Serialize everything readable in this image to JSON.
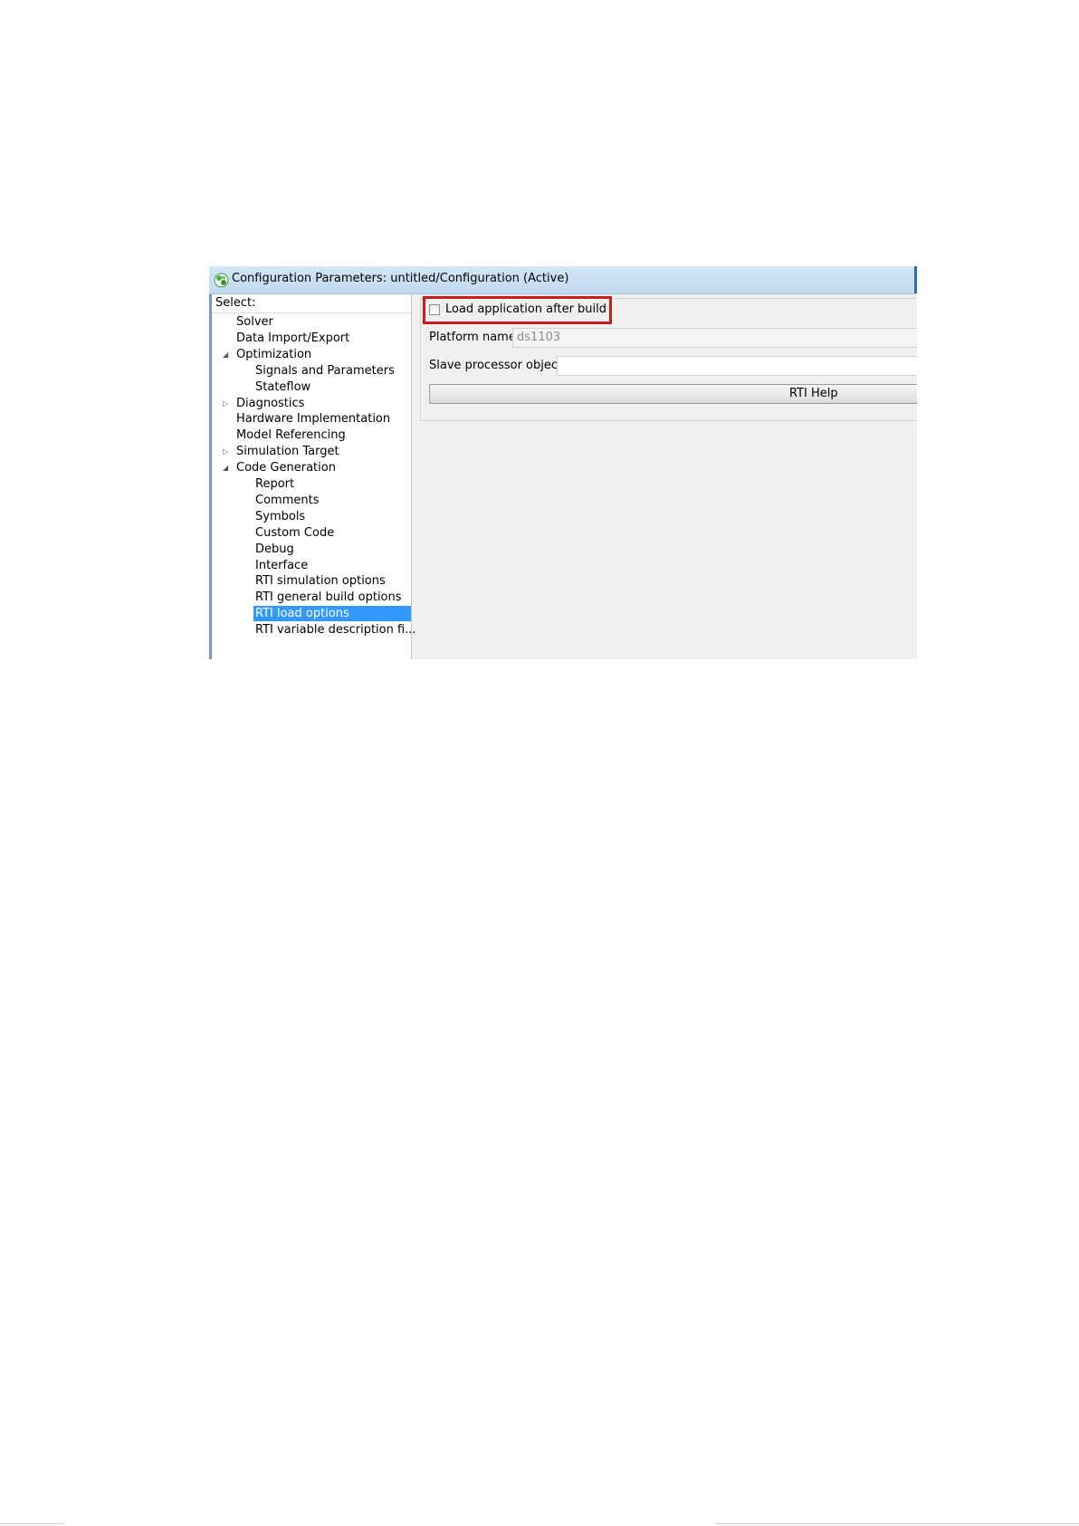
{
  "window": {
    "title": "Configuration Parameters: untitled/Configuration (Active)"
  },
  "tree": {
    "header": "Select:",
    "items": [
      {
        "label": "Solver",
        "level": 1,
        "expander": ""
      },
      {
        "label": "Data Import/Export",
        "level": 1,
        "expander": ""
      },
      {
        "label": "Optimization",
        "level": 1,
        "expander": "expanded"
      },
      {
        "label": "Signals and Parameters",
        "level": 2,
        "expander": ""
      },
      {
        "label": "Stateflow",
        "level": 2,
        "expander": ""
      },
      {
        "label": "Diagnostics",
        "level": 1,
        "expander": "collapsed"
      },
      {
        "label": "Hardware Implementation",
        "level": 1,
        "expander": ""
      },
      {
        "label": "Model Referencing",
        "level": 1,
        "expander": ""
      },
      {
        "label": "Simulation Target",
        "level": 1,
        "expander": "collapsed"
      },
      {
        "label": "Code Generation",
        "level": 1,
        "expander": "expanded"
      },
      {
        "label": "Report",
        "level": 2,
        "expander": ""
      },
      {
        "label": "Comments",
        "level": 2,
        "expander": ""
      },
      {
        "label": "Symbols",
        "level": 2,
        "expander": ""
      },
      {
        "label": "Custom Code",
        "level": 2,
        "expander": ""
      },
      {
        "label": "Debug",
        "level": 2,
        "expander": ""
      },
      {
        "label": "Interface",
        "level": 2,
        "expander": ""
      },
      {
        "label": "RTI simulation options",
        "level": 2,
        "expander": ""
      },
      {
        "label": "RTI general build options",
        "level": 2,
        "expander": ""
      },
      {
        "label": "RTI load options",
        "level": 2,
        "expander": "",
        "selected": true
      },
      {
        "label": "RTI variable description fi...",
        "level": 2,
        "expander": ""
      }
    ]
  },
  "options": {
    "load_checkbox_label": "Load application after build",
    "load_checkbox_checked": false,
    "platform_label": "Platform name:",
    "platform_value": "ds1103",
    "slave_label": "Slave processor object:",
    "slave_value": "",
    "help_button_label": "RTI Help"
  },
  "colors": {
    "selection": "#3399ff",
    "highlight_box": "#cc1b1b"
  }
}
